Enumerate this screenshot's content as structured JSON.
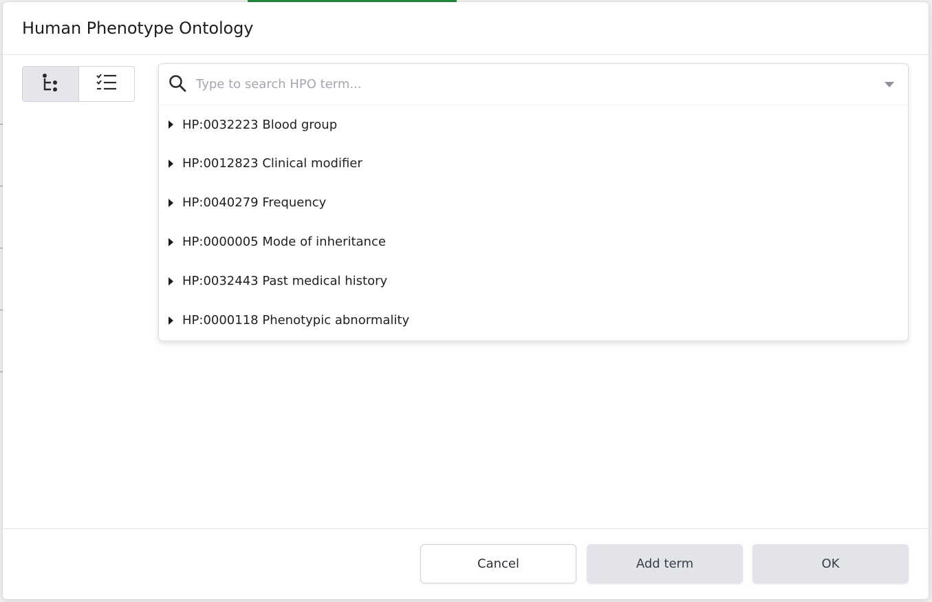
{
  "dialog": {
    "title": "Human Phenotype Ontology"
  },
  "view_toggle": {
    "options": [
      {
        "icon": "tree-view-icon",
        "active": true
      },
      {
        "icon": "checklist-view-icon",
        "active": false
      }
    ]
  },
  "search": {
    "placeholder": "Type to search HPO term...",
    "value": "",
    "icon": "search-icon",
    "dropdown_icon": "chevron-down-icon"
  },
  "tree": {
    "items": [
      {
        "label": "HP:0032223 Blood group"
      },
      {
        "label": "HP:0012823 Clinical modifier"
      },
      {
        "label": "HP:0040279 Frequency"
      },
      {
        "label": "HP:0000005 Mode of inheritance"
      },
      {
        "label": "HP:0032443 Past medical history"
      },
      {
        "label": "HP:0000118 Phenotypic abnormality"
      }
    ]
  },
  "footer": {
    "cancel_label": "Cancel",
    "add_term_label": "Add term",
    "ok_label": "OK"
  },
  "colors": {
    "background_accent": "#1f8a3c",
    "disabled_button": "#e2e4ea",
    "toggle_active": "#e4e6ec"
  }
}
